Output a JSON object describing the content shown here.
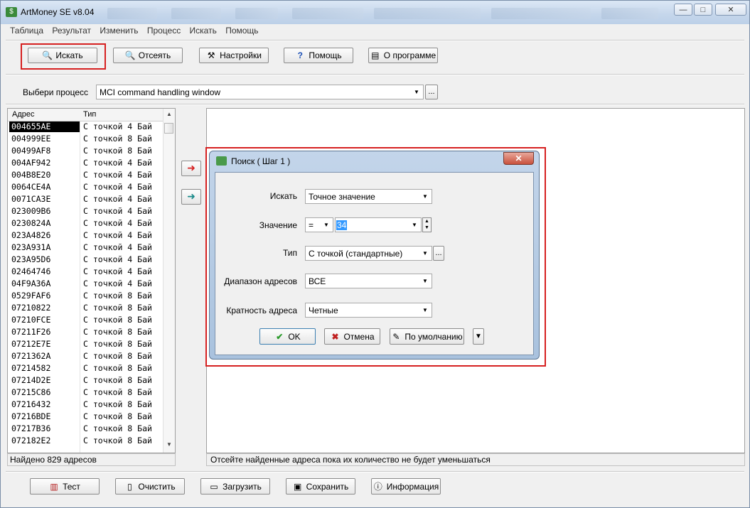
{
  "window": {
    "title": "ArtMoney SE v8.04",
    "minimize": "—",
    "maximize": "□",
    "close": "✕"
  },
  "menu": [
    "Таблица",
    "Результат",
    "Изменить",
    "Процесс",
    "Искать",
    "Помощь"
  ],
  "toolbar": {
    "search": "Искать",
    "filter": "Отсеять",
    "settings": "Настройки",
    "help": "Помощь",
    "about": "О программе"
  },
  "process": {
    "label": "Выбери процесс",
    "value": "MCI command handling window",
    "browse": "..."
  },
  "table": {
    "headers": [
      "Адрес",
      "Тип"
    ],
    "rows": [
      [
        "004655AE",
        "С точкой 4 Бай"
      ],
      [
        "004999EE",
        "С точкой 8 Бай"
      ],
      [
        "00499AF8",
        "С точкой 8 Бай"
      ],
      [
        "004AF942",
        "С точкой 4 Бай"
      ],
      [
        "004B8E20",
        "С точкой 4 Бай"
      ],
      [
        "0064CE4A",
        "С точкой 4 Бай"
      ],
      [
        "0071CA3E",
        "С точкой 4 Бай"
      ],
      [
        "023009B6",
        "С точкой 4 Бай"
      ],
      [
        "0230824A",
        "С точкой 4 Бай"
      ],
      [
        "023A4826",
        "С точкой 4 Бай"
      ],
      [
        "023A931A",
        "С точкой 4 Бай"
      ],
      [
        "023A95D6",
        "С точкой 4 Бай"
      ],
      [
        "02464746",
        "С точкой 4 Бай"
      ],
      [
        "04F9A36A",
        "С точкой 4 Бай"
      ],
      [
        "0529FAF6",
        "С точкой 8 Бай"
      ],
      [
        "07210822",
        "С точкой 8 Бай"
      ],
      [
        "07210FCE",
        "С точкой 8 Бай"
      ],
      [
        "07211F26",
        "С точкой 8 Бай"
      ],
      [
        "07212E7E",
        "С точкой 8 Бай"
      ],
      [
        "0721362A",
        "С точкой 8 Бай"
      ],
      [
        "07214582",
        "С точкой 8 Бай"
      ],
      [
        "07214D2E",
        "С точкой 8 Бай"
      ],
      [
        "07215C86",
        "С точкой 8 Бай"
      ],
      [
        "07216432",
        "С точкой 8 Бай"
      ],
      [
        "07216BDE",
        "С точкой 8 Бай"
      ],
      [
        "07217B36",
        "С точкой 8 Бай"
      ],
      [
        "072182E2",
        "С точкой 8 Бай"
      ]
    ]
  },
  "status": {
    "found": "Найдено 829 адресов",
    "hint": "Отсейте найденные адреса пока их количество не будет уменьшаться"
  },
  "bottom": {
    "test": "Тест",
    "clear": "Очистить",
    "load": "Загрузить",
    "save": "Сохранить",
    "info": "Информация"
  },
  "dialog": {
    "title": "Поиск ( Шаг 1 )",
    "close": "✕",
    "search_label": "Искать",
    "search_value": "Точное значение",
    "value_label": "Значение",
    "operator": "=",
    "value": "34",
    "type_label": "Тип",
    "type_value": "С точкой (стандартные)",
    "type_browse": "...",
    "range_label": "Диапазон адресов",
    "range_value": "ВСЕ",
    "align_label": "Кратность адреса",
    "align_value": "Четные",
    "ok": "OK",
    "cancel": "Отмена",
    "default": "По умолчанию"
  },
  "colors": {
    "highlight": "#d62020",
    "selection": "#000000",
    "value_selection": "#3399ff"
  }
}
